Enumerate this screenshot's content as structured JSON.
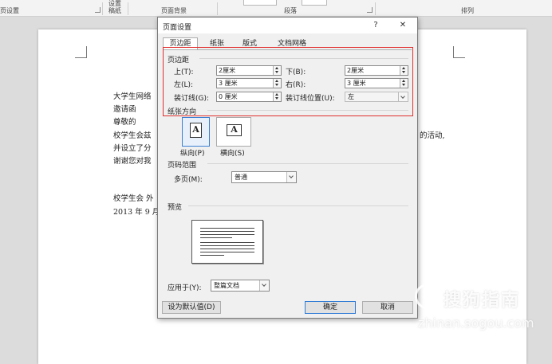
{
  "ribbon": {
    "left_label": "页设置",
    "draft_top": "设置",
    "draft_label": "稿纸",
    "bg_label": "页面背景",
    "para_label": "段落",
    "arrange_label": "排列"
  },
  "document": {
    "lines": [
      "大学生网络",
      "邀请函",
      "尊敬的",
      "校学生会兹",
      "并设立了分",
      "谢谢您对我",
      "",
      "",
      "校学生会 外",
      "2013 年 9 月"
    ],
    "right_fragment": "的活动,"
  },
  "dialog": {
    "title": "页面设置",
    "help": "?",
    "close": "✕",
    "tabs": [
      "页边距",
      "纸张",
      "版式",
      "文档网格"
    ],
    "margins": {
      "group": "页边距",
      "top_label": "上(T):",
      "top_value": "2厘米",
      "bottom_label": "下(B):",
      "bottom_value": "2厘米",
      "left_label": "左(L):",
      "left_value": "3 厘米",
      "right_label": "右(R):",
      "right_value": "3 厘米",
      "gutter_label": "装订线(G):",
      "gutter_value": "0 厘米",
      "gutter_pos_label": "装订线位置(U):",
      "gutter_pos_value": "左"
    },
    "orientation": {
      "group": "纸张方向",
      "portrait": "纵向(P)",
      "landscape": "横向(S)",
      "selected": "portrait"
    },
    "pages": {
      "group": "页码范围",
      "multi_label": "多页(M):",
      "multi_value": "普通"
    },
    "preview": {
      "group": "预览"
    },
    "apply_label": "应用于(Y):",
    "apply_value": "整篇文档",
    "default_button": "设为默认值(D)",
    "ok_button": "确定",
    "cancel_button": "取消"
  },
  "watermark": {
    "text": "搜狗指南",
    "url": "zhinan.sogou.com"
  }
}
